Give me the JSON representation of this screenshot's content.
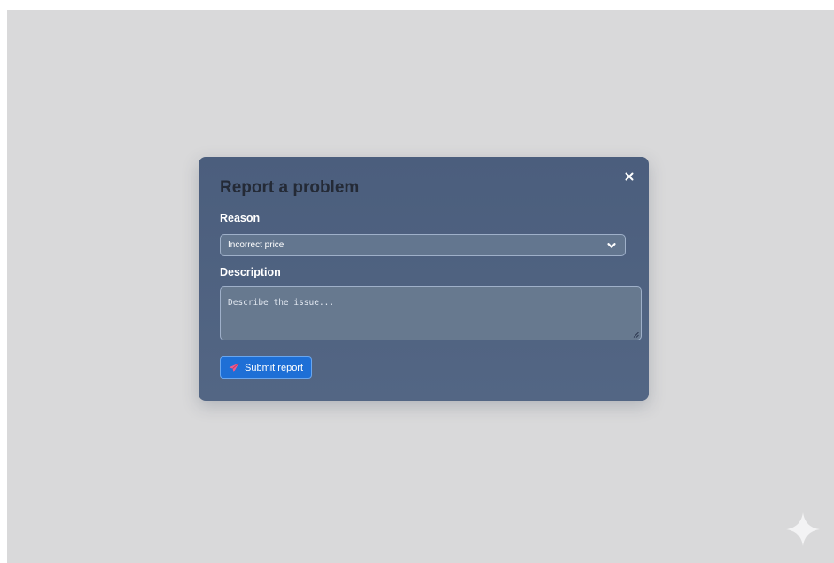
{
  "dialog": {
    "title": "Report a problem",
    "close_label": "×",
    "reason": {
      "label": "Reason",
      "selected_value": "Incorrect price"
    },
    "description": {
      "label": "Description",
      "placeholder": "Describe the issue..."
    },
    "submit_label": "Submit report"
  },
  "icons": {
    "close": "close-icon",
    "dropdown": "chevron-down-icon",
    "submit": "paper-plane-icon",
    "corner": "sparkle-icon"
  },
  "colors": {
    "backdrop": "#d9d9da",
    "modal": "#4f6281",
    "title": "#242a36",
    "field": "#63768f",
    "field_border": "#9fb0c9",
    "primary": "#1e6fd6",
    "plane": "#ec5b8f"
  }
}
